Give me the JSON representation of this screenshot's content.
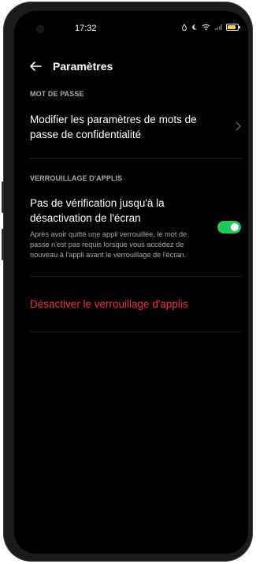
{
  "status_bar": {
    "time": "17:32",
    "icons": [
      "drop-icon",
      "moon-icon",
      "wifi-icon",
      "signal-icon",
      "battery-icon"
    ],
    "battery_color": "#f1d048"
  },
  "toolbar": {
    "back_icon": "arrow-left-icon",
    "title": "Paramètres"
  },
  "sections": {
    "password": {
      "header": "MOT DE PASSE",
      "item_title_line1": "Modifier les paramètres de mots de",
      "item_title_line2": "passe de confidentialité",
      "item_icon": "chevron-right-icon"
    },
    "lock": {
      "header": "VERROUILLAGE D'APPLIS",
      "item_title_line1": "Pas de vérification jusqu'à la",
      "item_title_line2": "désactivation de l'écran",
      "item_desc_line1": "Après avoir quitté une appli verrouillée, le mot de",
      "item_desc_line2": "passe n'est pas requis lorsque vous accédez de",
      "item_desc_line3": "nouveau à l'appli avant le verrouillage de l'écran.",
      "toggle_on": true,
      "toggle_color": "#22c55e"
    }
  },
  "actions": {
    "disable_lock": "Désactiver le verrouillage d'applis",
    "danger_color": "#e8333f"
  }
}
